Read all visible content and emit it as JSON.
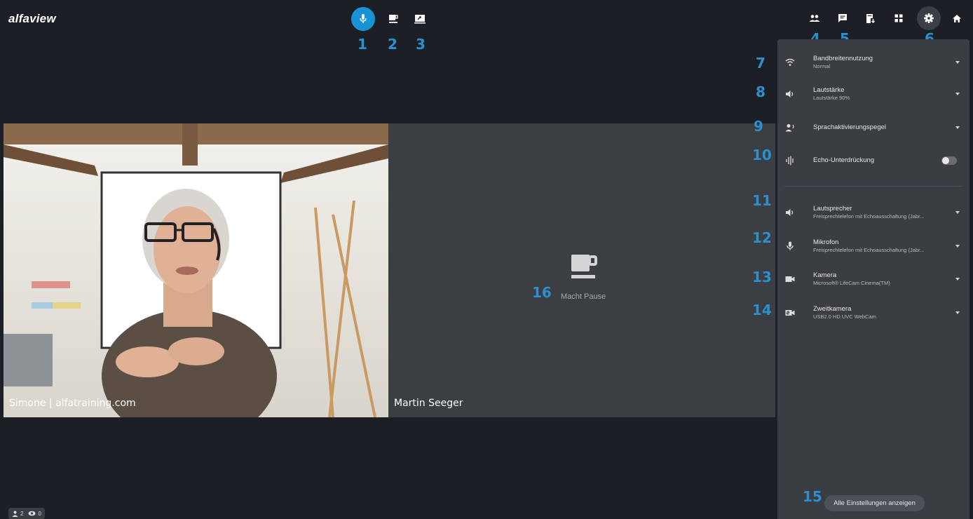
{
  "app": {
    "logo": "alfaview"
  },
  "toolbar_center": {
    "numbers": [
      "1",
      "2",
      "3"
    ]
  },
  "toolbar_right": {
    "numbers": [
      "4",
      "5",
      "6"
    ]
  },
  "videos": {
    "left": {
      "name": "Simone | alfatraining.com"
    },
    "right": {
      "name": "Martin Seeger",
      "status": "Macht Pause",
      "marker": "16"
    }
  },
  "settings_panel": {
    "rows": [
      {
        "num": "7",
        "title": "Bandbreitennutzung",
        "sub": "Normal",
        "icon": "wifi-icon"
      },
      {
        "num": "8",
        "title": "Lautstärke",
        "sub": "Lautstärke 90%",
        "icon": "volume-icon"
      },
      {
        "num": "9",
        "title": "Sprachaktivierungspegel",
        "sub": "",
        "icon": "voice-activation-icon"
      },
      {
        "num": "10",
        "title": "Echo-Unterdrückung",
        "sub": "",
        "icon": "waveform-icon"
      },
      {
        "num": "11",
        "title": "Lautsprecher",
        "sub": "Freisprechtelefon mit Echoausschaltung (Jabr...",
        "icon": "speaker-icon"
      },
      {
        "num": "12",
        "title": "Mikrofon",
        "sub": "Freisprechtelefon mit Echoausschaltung (Jabr...",
        "icon": "microphone-icon"
      },
      {
        "num": "13",
        "title": "Kamera",
        "sub": "Microsoft® LifeCam Cinema(TM)",
        "icon": "camera-icon"
      },
      {
        "num": "14",
        "title": "Zweitkamera",
        "sub": "USB2.0 HD UVC WebCam",
        "icon": "second-camera-icon"
      }
    ],
    "all_settings_num": "15",
    "all_settings_label": "Alle Einstellungen anzeigen"
  },
  "status_bar": {
    "participants": "2",
    "viewers": "0"
  },
  "colors": {
    "accent": "#1a93d6",
    "number_marker": "#2b90cf",
    "background": "#1c2026",
    "panel": "#3a3d42"
  }
}
